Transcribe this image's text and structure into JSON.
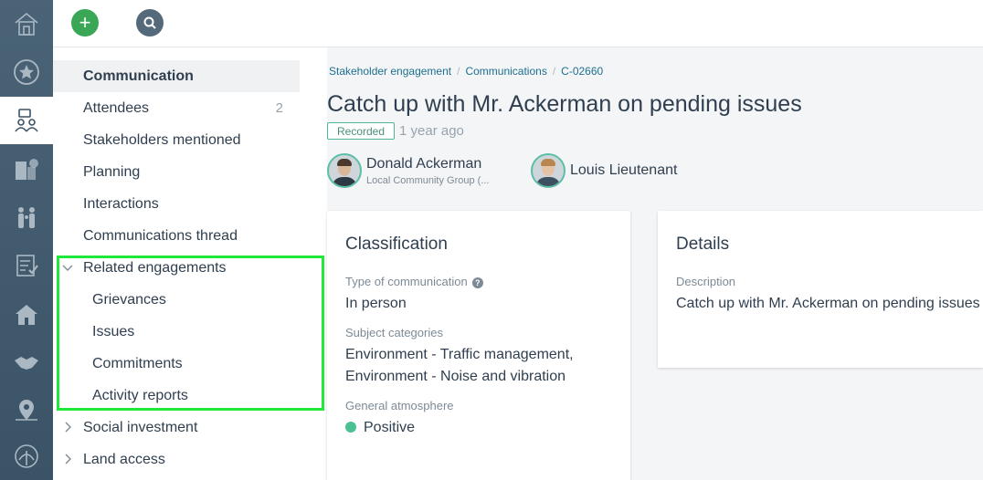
{
  "colors": {
    "rail": "#4a6377",
    "accent_green": "#3aa757",
    "link": "#1d6f8f",
    "positive": "#4cbf93",
    "highlight": "#1ee83a"
  },
  "rail": {
    "items": [
      {
        "icon": "home-icon"
      },
      {
        "icon": "star-icon"
      },
      {
        "icon": "stakeholder-engagement-icon",
        "active": true
      },
      {
        "icon": "buildings-icon"
      },
      {
        "icon": "people-icon"
      },
      {
        "icon": "checklist-icon"
      },
      {
        "icon": "community-icon"
      },
      {
        "icon": "handshake-icon"
      },
      {
        "icon": "map-pin-icon"
      },
      {
        "icon": "land-icon"
      }
    ]
  },
  "topbar": {
    "add_label": "+",
    "search_icon": "search-icon"
  },
  "subnav": {
    "items": [
      {
        "label": "Communication",
        "active": true
      },
      {
        "label": "Attendees",
        "count": "2"
      },
      {
        "label": "Stakeholders mentioned"
      },
      {
        "label": "Planning"
      },
      {
        "label": "Interactions"
      },
      {
        "label": "Communications thread"
      },
      {
        "label": "Related engagements",
        "expanded": true
      },
      {
        "label": "Grievances",
        "child": true
      },
      {
        "label": "Issues",
        "child": true
      },
      {
        "label": "Commitments",
        "child": true
      },
      {
        "label": "Activity reports",
        "child": true
      },
      {
        "label": "Social investment",
        "collapsed": true
      },
      {
        "label": "Land access",
        "collapsed": true
      }
    ]
  },
  "breadcrumb": [
    "Stakeholder engagement",
    "Communications",
    "C-02660"
  ],
  "header": {
    "title": "Catch up with Mr. Ackerman on pending issues",
    "status_badge": "Recorded",
    "time_ago": "1 year ago"
  },
  "people": [
    {
      "name": "Donald Ackerman",
      "org": "Local Community Group (..."
    },
    {
      "name": "Louis Lieutenant",
      "org": ""
    }
  ],
  "classification": {
    "title": "Classification",
    "type_label": "Type of communication",
    "type_value": "In person",
    "subject_label": "Subject categories",
    "subject_line1": "Environment - Traffic management,",
    "subject_line2": "Environment - Noise and vibration",
    "atmosphere_label": "General atmosphere",
    "atmosphere_value": "Positive"
  },
  "details": {
    "title": "Details",
    "description_label": "Description",
    "description_value": "Catch up with Mr. Ackerman on pending issues"
  }
}
